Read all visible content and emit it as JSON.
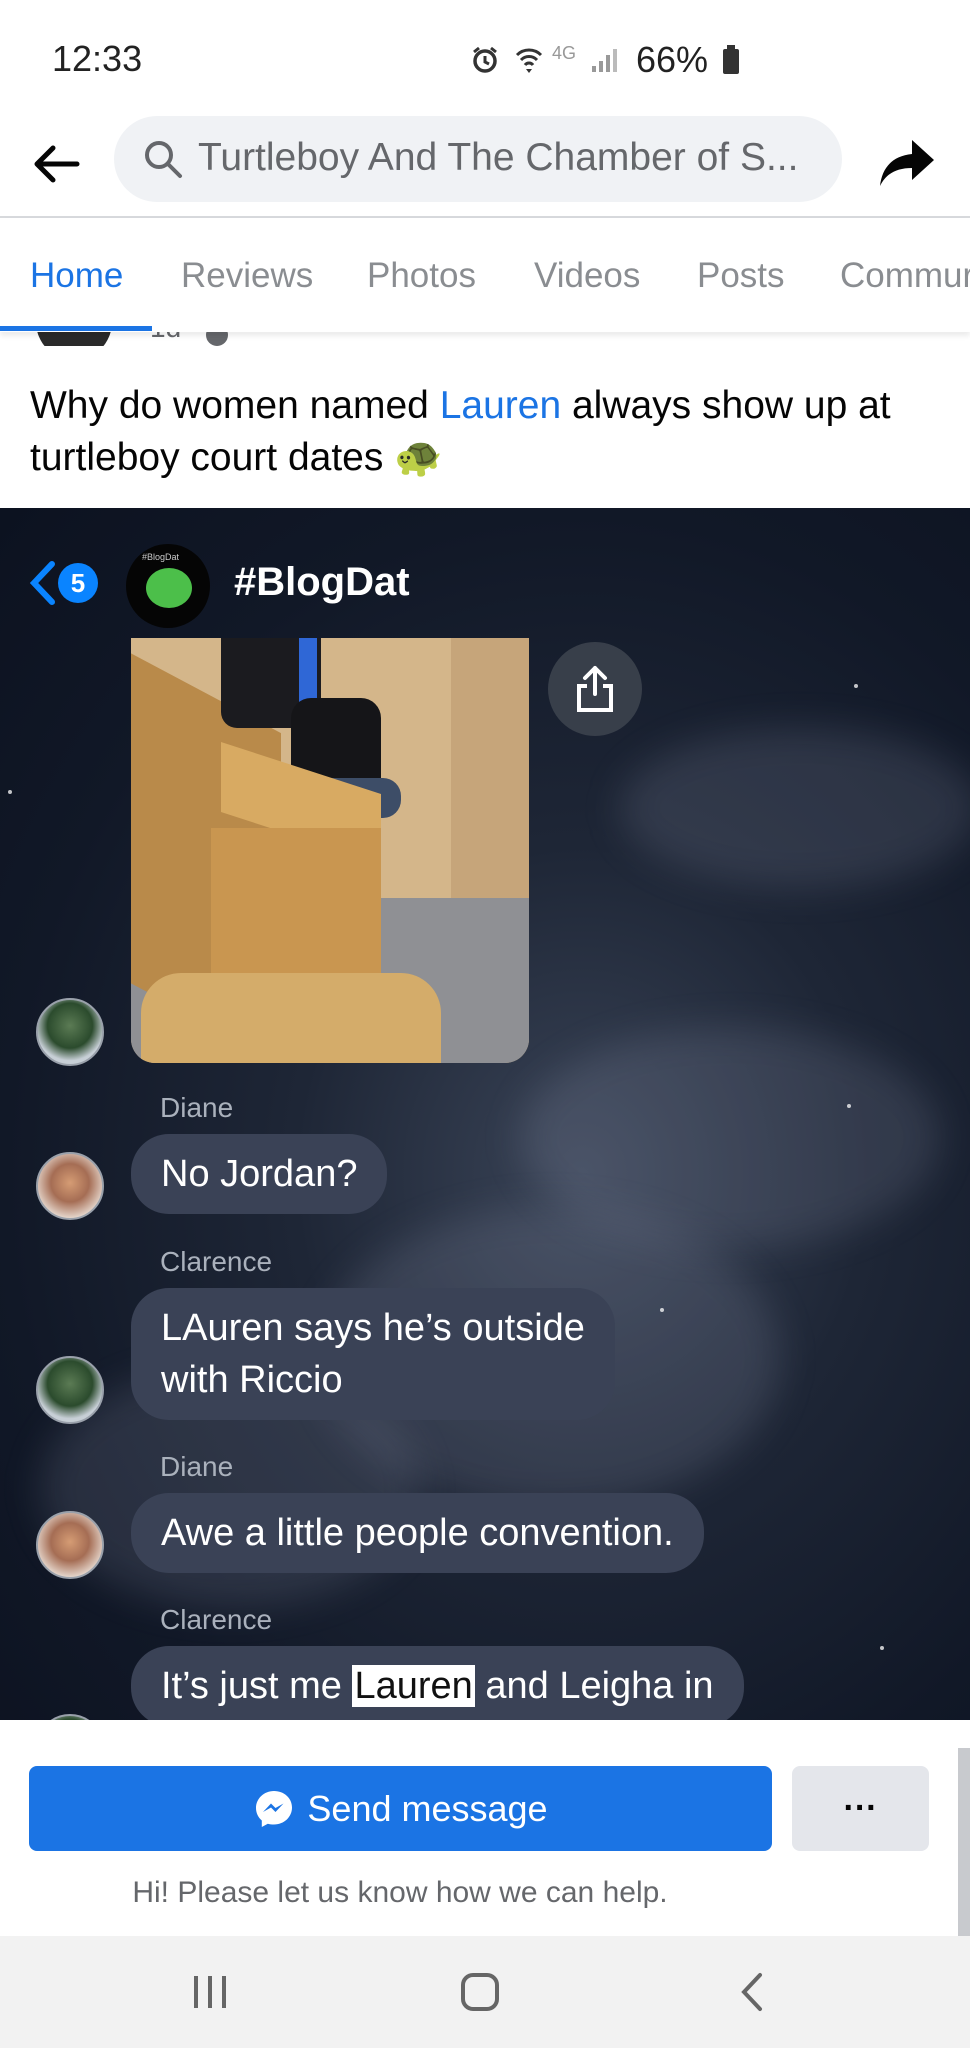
{
  "status_bar": {
    "time": "12:33",
    "network": "4G",
    "battery": "66%"
  },
  "header": {
    "search_text": "Turtleboy And The Chamber of S...",
    "icons": [
      "back-arrow-icon",
      "search-icon",
      "share-icon"
    ]
  },
  "tabs": [
    {
      "label": "Home",
      "active": true
    },
    {
      "label": "Reviews",
      "active": false
    },
    {
      "label": "Photos",
      "active": false
    },
    {
      "label": "Videos",
      "active": false
    },
    {
      "label": "Posts",
      "active": false
    },
    {
      "label": "Commur",
      "active": false
    }
  ],
  "post": {
    "time_peek": "1d",
    "text_before": "Why do women named ",
    "mention": "Lauren",
    "text_after": " always show up at turtleboy court dates 🐢"
  },
  "embedded_chat": {
    "back_count": "5",
    "group_tiny_label": "#BlogDat",
    "group_name": "#BlogDat",
    "messages": [
      {
        "sender": "Diane",
        "text": "No Jordan?"
      },
      {
        "sender": "Clarence",
        "line1": "LAuren says he’s outside",
        "line2": "with Riccio"
      },
      {
        "sender": "Diane",
        "text": "Awe a little people convention."
      },
      {
        "sender": "Clarence",
        "before": "It’s just me ",
        "highlight": "Lauren",
        "after": " and Leigha in"
      }
    ]
  },
  "action": {
    "send_label": "Send message",
    "more_label": "···",
    "helper_text": "Hi! Please let us know how we can help."
  },
  "colors": {
    "accent": "#1b74e4",
    "chat_bubble": "#3a4256"
  }
}
